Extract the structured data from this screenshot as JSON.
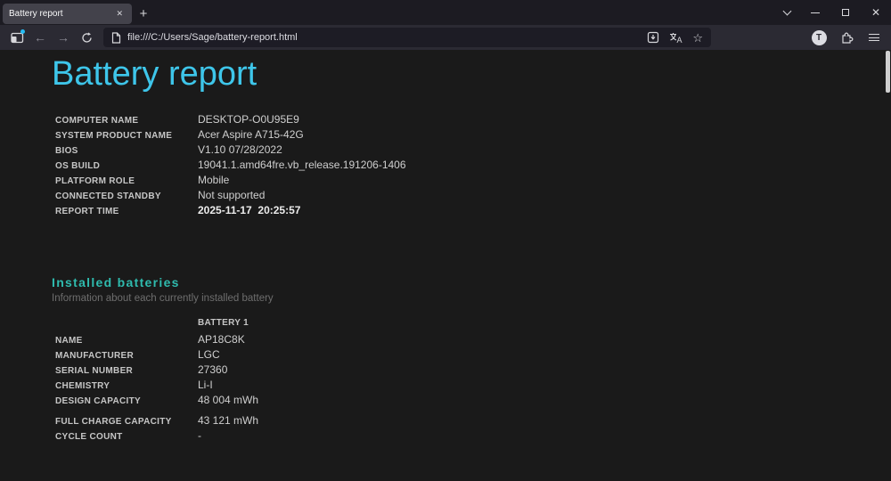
{
  "browser": {
    "tab_title": "Battery report",
    "tab_close_label": "✕",
    "new_tab_label": "+",
    "url": "file:///C:/Users/Sage/battery-report.html",
    "avatar_letter": "T",
    "star_glyph": "☆",
    "back_glyph": "←",
    "forward_glyph": "→",
    "close_glyph": "✕"
  },
  "colors": {
    "title_cyan": "#3ec6ea",
    "section_teal": "#2fbbae",
    "notification_dot": "#26bcf3",
    "page_background": "#1a1a1a",
    "tabbar_background": "#1c1b22",
    "toolbar_background": "#2b2a33"
  },
  "page": {
    "title": "Battery report",
    "system_info": [
      {
        "label": "COMPUTER NAME",
        "value": "DESKTOP-O0U95E9"
      },
      {
        "label": "SYSTEM PRODUCT NAME",
        "value": "Acer Aspire A715-42G"
      },
      {
        "label": "BIOS",
        "value": "V1.10 07/28/2022"
      },
      {
        "label": "OS BUILD",
        "value": "19041.1.amd64fre.vb_release.191206-1406"
      },
      {
        "label": "PLATFORM ROLE",
        "value": "Mobile"
      },
      {
        "label": "CONNECTED STANDBY",
        "value": "Not supported"
      },
      {
        "label": "REPORT TIME",
        "value": "2025-11-17  20:25:57",
        "bold": true
      }
    ],
    "installed_batteries": {
      "heading": "Installed batteries",
      "subtitle": "Information about each currently installed battery",
      "column_header": "BATTERY 1",
      "rows": [
        {
          "label": "NAME",
          "value": "AP18C8K"
        },
        {
          "label": "MANUFACTURER",
          "value": "LGC"
        },
        {
          "label": "SERIAL NUMBER",
          "value": "27360"
        },
        {
          "label": "CHEMISTRY",
          "value": "Li-I"
        },
        {
          "label": "DESIGN CAPACITY",
          "value": "48 004 mWh"
        },
        {
          "label": "FULL CHARGE CAPACITY",
          "value": "43 121 mWh",
          "gap": true
        },
        {
          "label": "CYCLE COUNT",
          "value": "-"
        }
      ]
    }
  }
}
